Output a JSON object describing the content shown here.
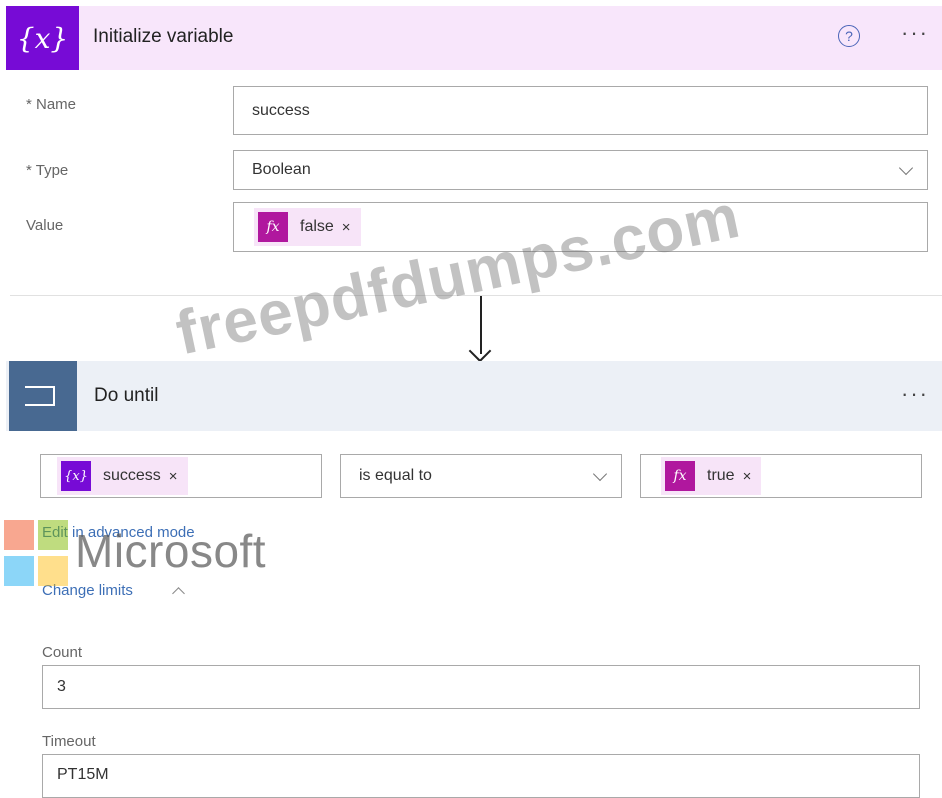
{
  "init_variable": {
    "title": "Initialize variable",
    "icon": "variable-icon",
    "icon_text": "{x}",
    "name_label": "* Name",
    "name_value": "success",
    "type_label": "* Type",
    "type_value": "Boolean",
    "value_label": "Value",
    "value_token": "false",
    "value_token_icon": "fx-icon",
    "value_token_icon_text": "fx",
    "remove_symbol": "×"
  },
  "do_until": {
    "title": "Do until",
    "icon": "loop-icon",
    "condition": {
      "left_token": "success",
      "left_token_icon": "variable-icon",
      "left_token_icon_text": "{x}",
      "operator": "is equal to",
      "right_token": "true",
      "right_token_icon": "fx-icon",
      "right_token_icon_text": "fx",
      "remove_symbol": "×"
    },
    "advanced_mode_link": "Edit in advanced mode",
    "change_limits_link": "Change limits",
    "count_label": "Count",
    "count_value": "3",
    "timeout_label": "Timeout",
    "timeout_value": "PT15M"
  },
  "menu_symbol": "···",
  "help_symbol": "?",
  "watermarks": {
    "site": "freepdfdumps.com",
    "brand": "Microsoft",
    "brand_colors": [
      "#f25022",
      "#7fba00",
      "#00a4ef",
      "#ffb900"
    ]
  }
}
